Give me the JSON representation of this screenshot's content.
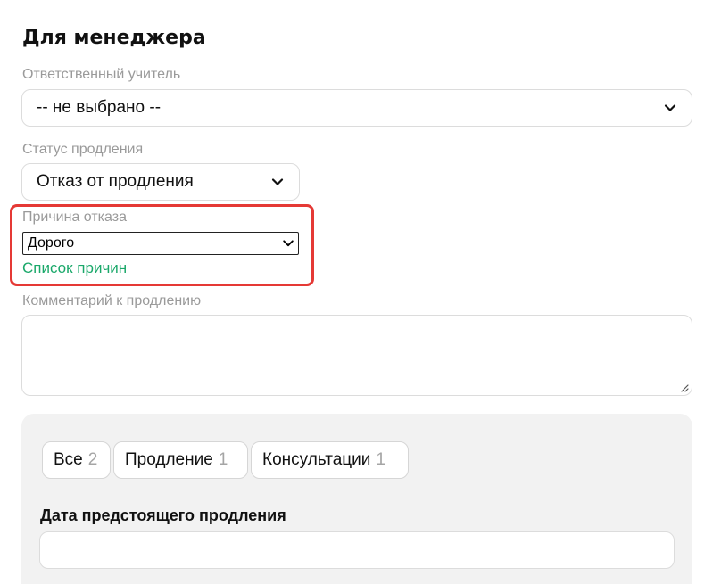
{
  "section": {
    "title": "Для менеджера"
  },
  "teacher": {
    "label": "Ответственный учитель",
    "value": "-- не выбрано --"
  },
  "renewal_status": {
    "label": "Статус продления",
    "value": "Отказ от продления"
  },
  "refusal_reason": {
    "label": "Причина отказа",
    "value": "Дорого",
    "link": "Список причин",
    "highlight_color": "#e53935"
  },
  "comment": {
    "label": "Комментарий к продлению",
    "value": ""
  },
  "tabs": [
    {
      "label": "Все",
      "count": "2"
    },
    {
      "label": "Продление",
      "count": "1"
    },
    {
      "label": "Консультации",
      "count": "1"
    }
  ],
  "upcoming_renewal": {
    "label": "Дата предстоящего продления",
    "value": ""
  },
  "colors": {
    "accent_link": "#1aa86a",
    "panel_bg": "#f2f2f2",
    "muted_text": "#9a9a9a"
  },
  "icons": {
    "select_chevron": "chevron-down-icon",
    "textarea_resize": "resize-handle-icon"
  }
}
